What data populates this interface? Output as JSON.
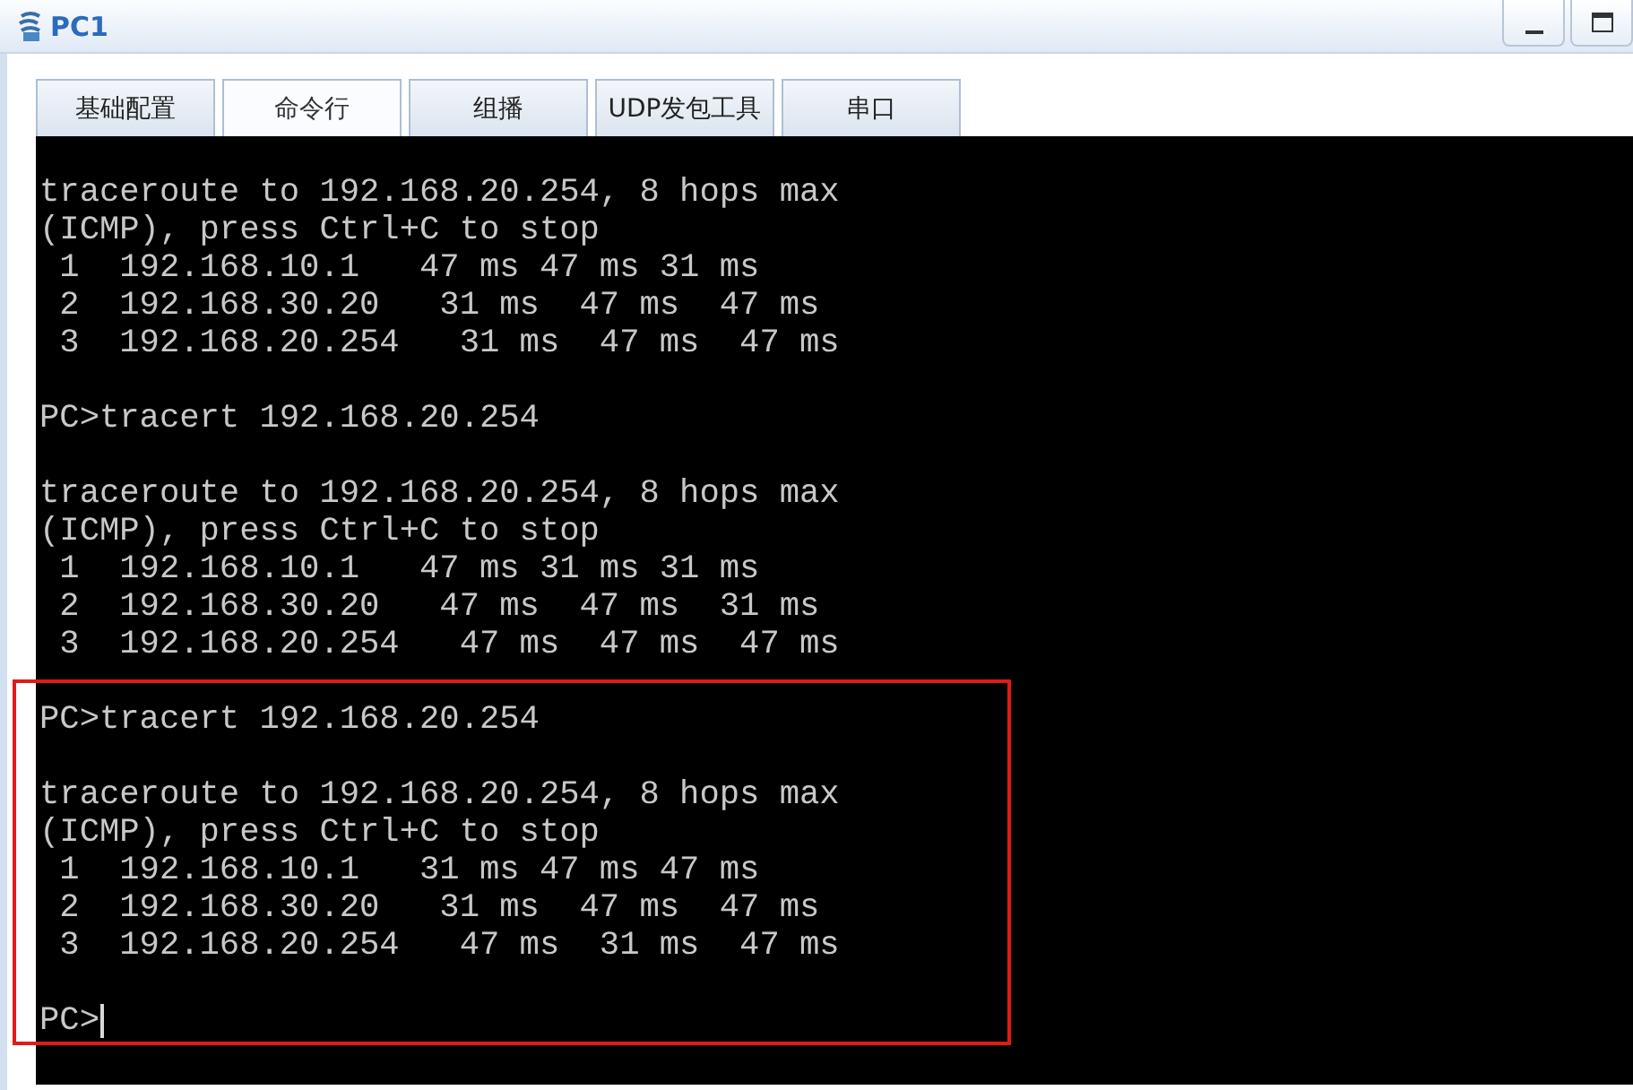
{
  "window": {
    "title": "PC1"
  },
  "tabs": [
    {
      "label": "基础配置",
      "selected": false
    },
    {
      "label": "命令行",
      "selected": true
    },
    {
      "label": "组播",
      "selected": false
    },
    {
      "label": "UDP发包工具",
      "selected": false
    },
    {
      "label": "串口",
      "selected": false
    }
  ],
  "terminal": {
    "cursor": true,
    "blocks": [
      {
        "highlighted": false,
        "lines": [
          "traceroute to 192.168.20.254, 8 hops max",
          "(ICMP), press Ctrl+C to stop",
          " 1  192.168.10.1   47 ms 47 ms 31 ms",
          " 2  192.168.30.20   31 ms  47 ms  47 ms",
          " 3  192.168.20.254   31 ms  47 ms  47 ms"
        ]
      },
      {
        "highlighted": false,
        "lines": [
          "PC>tracert 192.168.20.254"
        ]
      },
      {
        "highlighted": false,
        "lines": [
          "traceroute to 192.168.20.254, 8 hops max",
          "(ICMP), press Ctrl+C to stop",
          " 1  192.168.10.1   47 ms 31 ms 31 ms",
          " 2  192.168.30.20   47 ms  47 ms  31 ms",
          " 3  192.168.20.254   47 ms  47 ms  47 ms"
        ]
      },
      {
        "highlighted": true,
        "lines": [
          "PC>tracert 192.168.20.254"
        ]
      },
      {
        "highlighted": true,
        "lines": [
          "traceroute to 192.168.20.254, 8 hops max",
          "(ICMP), press Ctrl+C to stop",
          " 1  192.168.10.1   31 ms 47 ms 47 ms",
          " 2  192.168.30.20   31 ms  47 ms  47 ms",
          " 3  192.168.20.254   47 ms  31 ms  47 ms"
        ]
      },
      {
        "highlighted": true,
        "lines": [
          "PC>"
        ]
      }
    ]
  }
}
